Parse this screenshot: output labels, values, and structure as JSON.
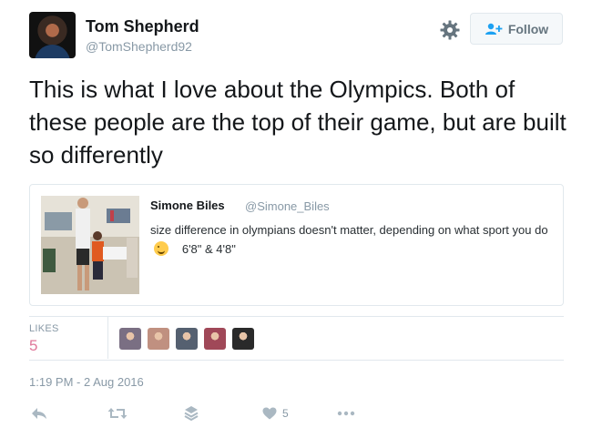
{
  "author": {
    "name": "Tom Shepherd",
    "handle": "@TomShepherd92"
  },
  "follow_label": "Follow",
  "tweet_text": "This is what I love about the Olympics. Both of these people are the top of their game, but are built so differently",
  "quoted": {
    "name": "Simone Biles",
    "handle": "@Simone_Biles",
    "text_part1": "size difference in olympians doesn't matter, depending on what sport you do",
    "emoji": "winking-face",
    "text_part2": "6'8\" & 4'8\""
  },
  "stats": {
    "likes_label": "LIKES",
    "likes_count": "5",
    "liker_colors": [
      "#7a6f83",
      "#c09080",
      "#556070",
      "#a04858",
      "#2a2a2a"
    ]
  },
  "timestamp": "1:19 PM - 2 Aug 2016",
  "actions": {
    "like_count": "5"
  },
  "icons": [
    "gear-icon",
    "follow-person-icon",
    "reply-icon",
    "retweet-icon",
    "stack-icon",
    "heart-icon",
    "more-icon"
  ],
  "colors": {
    "like_accent": "#e0789a",
    "muted": "#8899a6",
    "icon_grey": "#aab8c2"
  }
}
